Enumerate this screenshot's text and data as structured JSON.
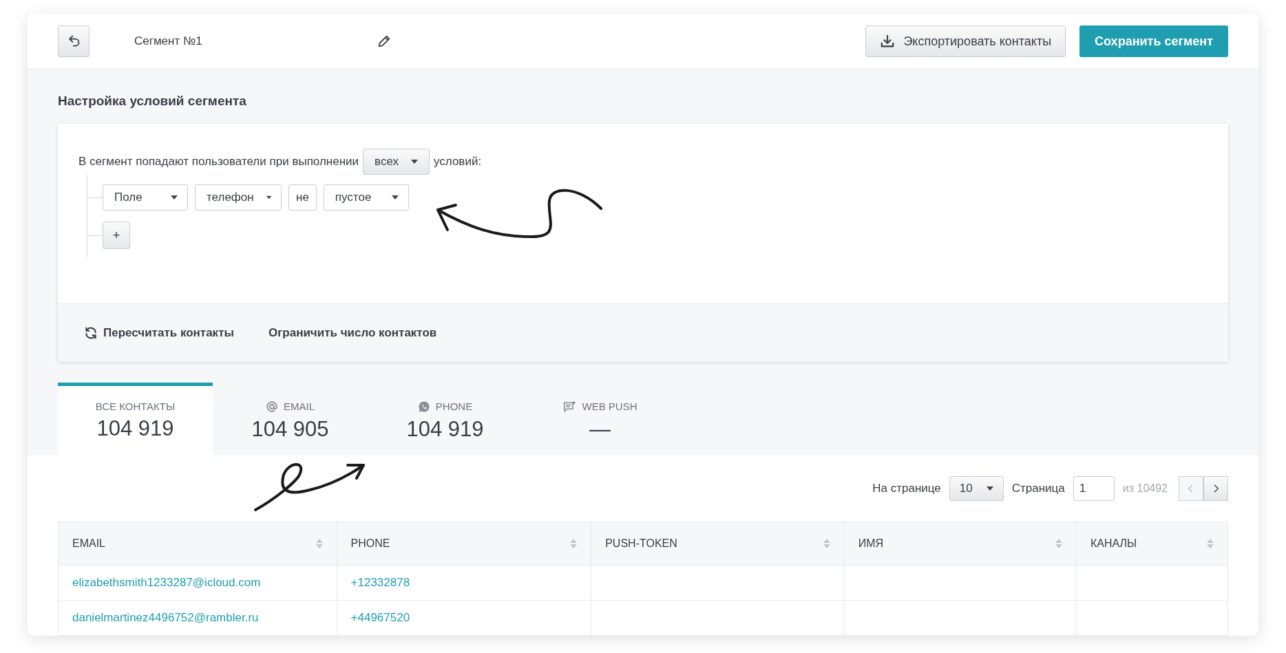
{
  "header": {
    "title": "Сегмент №1",
    "export_button": "Экспортировать контакты",
    "save_button": "Сохранить сегмент"
  },
  "conditions": {
    "heading": "Настройка условий сегмента",
    "intro_before": "В сегмент попадают пользователи при выполнении",
    "match_select": "всех",
    "intro_after": "условий:",
    "rule": [
      {
        "kind": "select",
        "value": "Поле"
      },
      {
        "kind": "select",
        "value": "телефон"
      },
      {
        "kind": "label",
        "value": "не"
      },
      {
        "kind": "select",
        "value": "пустое"
      }
    ],
    "add_button": "+",
    "actions": [
      {
        "kind": "refresh",
        "label": "Пересчитать контакты"
      },
      {
        "kind": "plain",
        "label": "Ограничить число контактов"
      }
    ]
  },
  "tabs": [
    {
      "kind": "all",
      "label": "ВСЕ КОНТАКТЫ",
      "count": "104 919",
      "selected": true
    },
    {
      "kind": "email",
      "label": "EMAIL",
      "count": "104 905",
      "selected": false
    },
    {
      "kind": "phone",
      "label": "PHONE",
      "count": "104 919",
      "selected": false
    },
    {
      "kind": "webpush",
      "label": "WEB PUSH",
      "count": "—",
      "selected": false
    }
  ],
  "pagination": {
    "per_page_label": "На странице",
    "per_page": "10",
    "page_label": "Страница",
    "page": "1",
    "total": "из 10492",
    "prev": {
      "disabled": true
    },
    "next": {
      "disabled": false
    }
  },
  "table": {
    "columns": [
      "EMAIL",
      "PHONE",
      "PUSH-TOKEN",
      "ИМЯ",
      "КАНАЛЫ"
    ],
    "rows": [
      [
        "elizabethsmith1233287@icloud.com",
        "+12332878",
        "",
        "",
        ""
      ],
      [
        "danielmartinez4496752@rambler.ru",
        "+44967520",
        "",
        "",
        ""
      ]
    ]
  }
}
